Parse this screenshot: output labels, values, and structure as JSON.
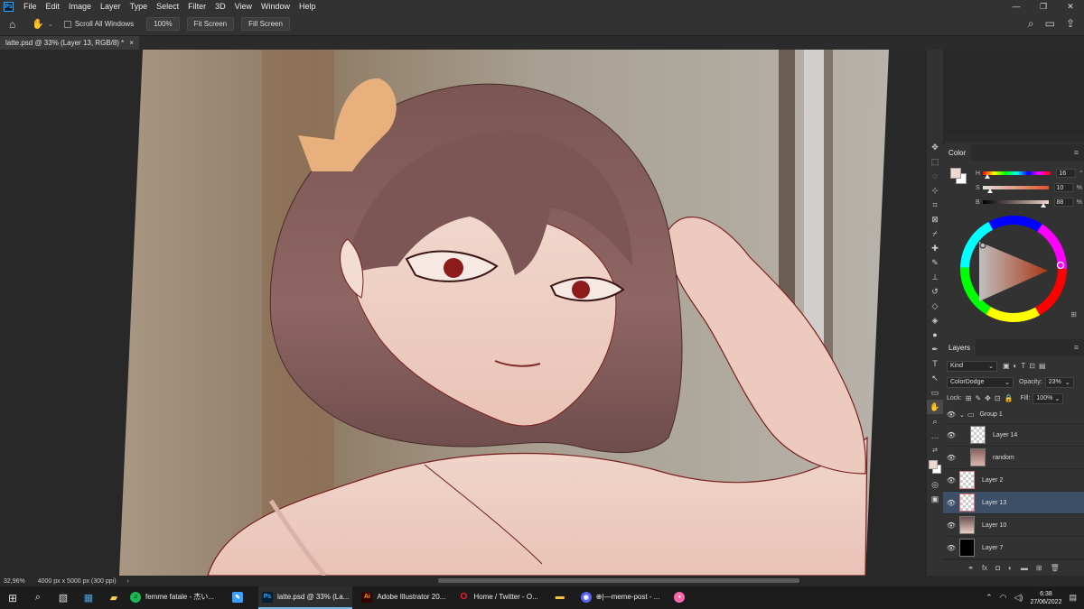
{
  "menu": {
    "logo": "Ps",
    "items": [
      "File",
      "Edit",
      "Image",
      "Layer",
      "Type",
      "Select",
      "Filter",
      "3D",
      "View",
      "Window",
      "Help"
    ],
    "window_controls": [
      "—",
      "❐",
      "✕"
    ]
  },
  "options": {
    "scroll_all_label": "Scroll All Windows",
    "zoom_button": "100%",
    "fit_button": "Fit Screen",
    "fill_button": "Fill Screen"
  },
  "document": {
    "tab_title": "latte.psd @ 33% (Layer 13, RGB/8) *",
    "tab_close": "×"
  },
  "color_panel": {
    "title": "Color",
    "h_label": "H",
    "h_value": "16",
    "s_label": "S",
    "s_value": "10",
    "s_unit": "%",
    "b_label": "B",
    "b_value": "88",
    "b_unit": "%",
    "h_level": 0.044,
    "s_level": 0.1,
    "b_level": 0.88,
    "fg_color": "#efd8cf"
  },
  "layers_panel": {
    "title": "Layers",
    "filter_kind": "Kind",
    "blend_mode": "ColorDodge",
    "opacity_label": "Opacity:",
    "opacity_value": "23%",
    "lock_label": "Lock:",
    "fill_label": "Fill:",
    "fill_value": "100%",
    "layers": [
      {
        "name": "Group 1",
        "type": "group",
        "visible": true
      },
      {
        "name": "Layer 14",
        "type": "layer",
        "visible": true
      },
      {
        "name": "random",
        "type": "layer",
        "visible": true
      },
      {
        "name": "Layer 2",
        "type": "layer",
        "visible": true
      },
      {
        "name": "Layer 13",
        "type": "layer",
        "visible": true,
        "selected": true
      },
      {
        "name": "Layer 10",
        "type": "layer",
        "visible": true
      },
      {
        "name": "Layer 7",
        "type": "layer",
        "visible": true
      }
    ]
  },
  "status": {
    "zoom": "32,96%",
    "dimensions": "4000 px x 5000 px (300 ppi)"
  },
  "taskbar": {
    "apps": [
      {
        "label": "femme fatale - 杰い...",
        "icon": "spotify-icon",
        "color": "#1db954",
        "glyph": "♫"
      },
      {
        "label": "",
        "icon": "pen-app-icon",
        "color": "#3aa0ff",
        "glyph": "✎"
      },
      {
        "label": "latte.psd @ 33% (La...",
        "icon": "photoshop-icon",
        "color": "#31a8ff",
        "glyph": "Ps",
        "active": true
      },
      {
        "label": "Adobe Illustrator 20...",
        "icon": "illustrator-icon",
        "color": "#ff9a00",
        "glyph": "Ai"
      },
      {
        "label": "Home / Twitter - O...",
        "icon": "opera-icon",
        "color": "#ff1b2d",
        "glyph": "O"
      },
      {
        "label": "",
        "icon": "folder-icon",
        "color": "#f5c242",
        "glyph": "▬"
      },
      {
        "label": "⊕|—meme-post - ...",
        "icon": "discord-icon",
        "color": "#5865f2",
        "glyph": "◉"
      },
      {
        "label": "",
        "icon": "osu-icon",
        "color": "#ff66aa",
        "glyph": "●"
      }
    ],
    "time": "6:38",
    "date": "27/06/2022"
  }
}
